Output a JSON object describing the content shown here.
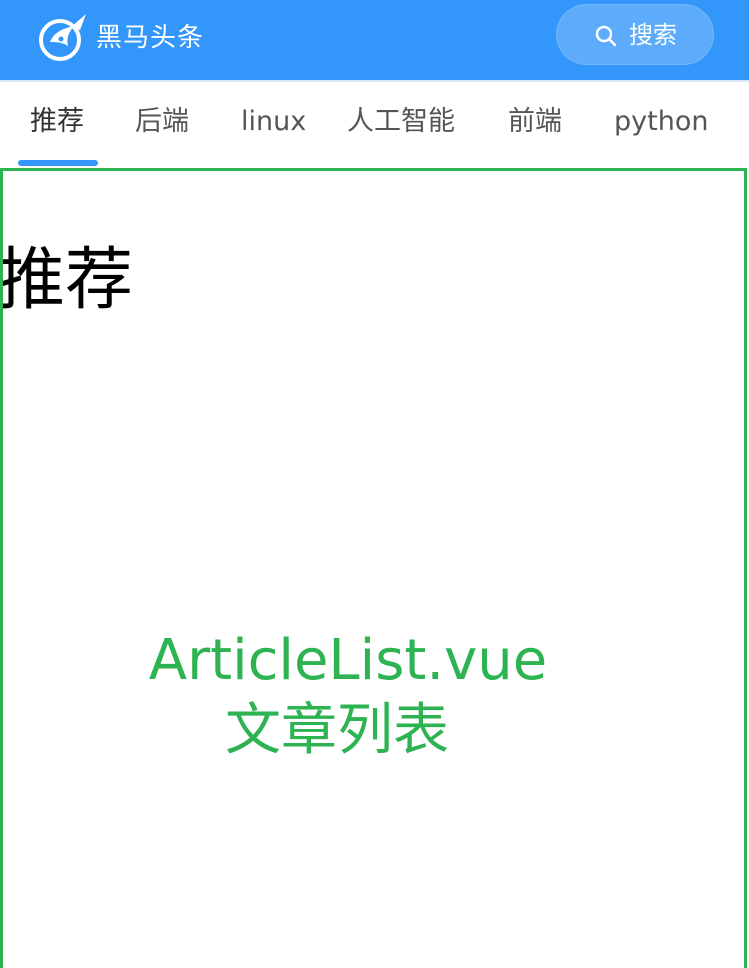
{
  "header": {
    "brand": "黑马头条",
    "search_label": "搜索"
  },
  "tabs": [
    {
      "label": "推荐",
      "active": true
    },
    {
      "label": "后端",
      "active": false
    },
    {
      "label": "linux",
      "active": false
    },
    {
      "label": "人工智能",
      "active": false
    },
    {
      "label": "前端",
      "active": false
    },
    {
      "label": "python",
      "active": false
    }
  ],
  "content": {
    "panel_title": "推荐",
    "placeholder_file": "ArticleList.vue",
    "placeholder_desc": "文章列表"
  },
  "colors": {
    "primary": "#3296fa",
    "search_button": "#5cacfb",
    "placeholder_green": "#2db352"
  },
  "icons": {
    "logo": "toutiao-logo-icon",
    "search": "search-icon"
  }
}
